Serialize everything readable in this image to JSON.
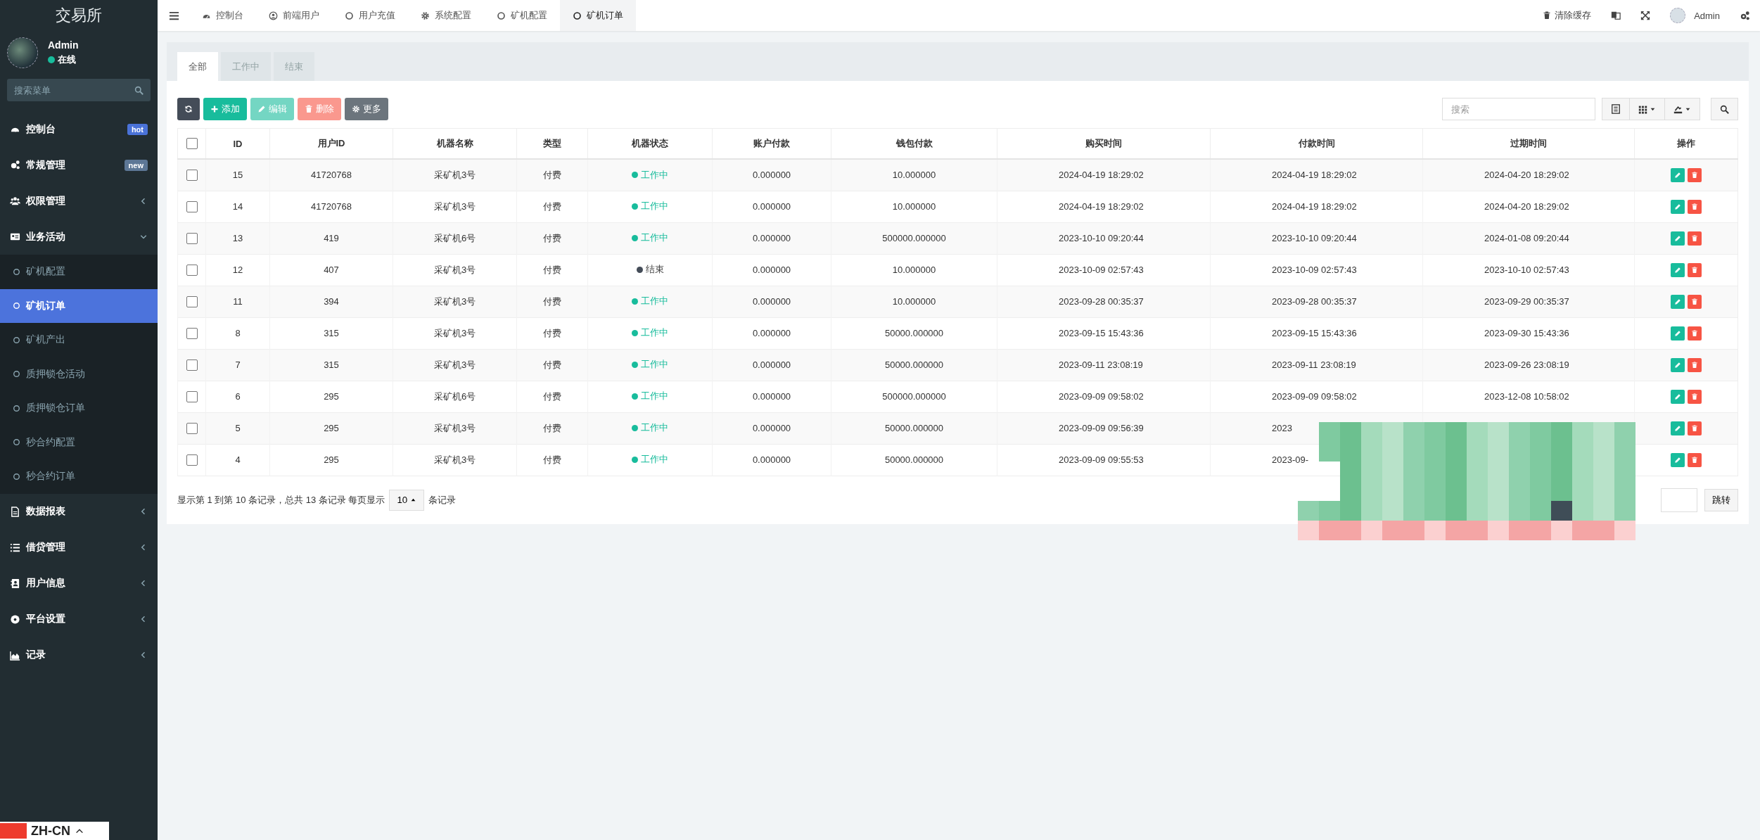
{
  "sidebar": {
    "brand": "交易所",
    "user": {
      "name": "Admin",
      "status": "在线",
      "online": true
    },
    "search": {
      "placeholder": "搜索菜单"
    },
    "items": [
      {
        "label": "控制台",
        "badge": {
          "text": "hot",
          "color": "#4a72d8"
        }
      },
      {
        "label": "常规管理",
        "badge": {
          "text": "new",
          "color": "#5d7796"
        }
      },
      {
        "label": "权限管理",
        "expanded": false
      },
      {
        "label": "业务活动",
        "expanded": true,
        "children": [
          {
            "label": "矿机配置",
            "selected": false
          },
          {
            "label": "矿机订单",
            "selected": true
          },
          {
            "label": "矿机产出",
            "selected": false
          },
          {
            "label": "质押锁仓活动",
            "selected": false
          },
          {
            "label": "质押锁仓订单",
            "selected": false
          },
          {
            "label": "秒合约配置",
            "selected": false
          },
          {
            "label": "秒合约订单",
            "selected": false
          }
        ]
      },
      {
        "label": "数据报表",
        "expanded": false
      },
      {
        "label": "借贷管理",
        "expanded": false
      },
      {
        "label": "用户信息",
        "expanded": false
      },
      {
        "label": "平台设置",
        "expanded": false
      },
      {
        "label": "记录",
        "expanded": false
      }
    ],
    "language": "ZH-CN"
  },
  "topbar": {
    "tabs": [
      {
        "label": "控制台",
        "selected": false
      },
      {
        "label": "前端用户",
        "selected": false
      },
      {
        "label": "用户充值",
        "selected": false
      },
      {
        "label": "系统配置",
        "selected": false
      },
      {
        "label": "矿机配置",
        "selected": false
      },
      {
        "label": "矿机订单",
        "selected": true
      }
    ],
    "clear_cache": "清除缓存",
    "user": "Admin"
  },
  "panel": {
    "tabs": [
      {
        "label": "全部",
        "selected": true
      },
      {
        "label": "工作中",
        "selected": false
      },
      {
        "label": "结束",
        "selected": false
      }
    ],
    "toolbar": [
      {
        "kind": "refresh",
        "disabled": false
      },
      {
        "kind": "add",
        "label": "添加",
        "disabled": false
      },
      {
        "kind": "edit",
        "label": "编辑",
        "disabled": true
      },
      {
        "kind": "delete",
        "label": "删除",
        "disabled": true
      },
      {
        "kind": "more",
        "label": "更多",
        "disabled": false
      }
    ],
    "search": {
      "placeholder": "搜索"
    },
    "table": {
      "select_all": {
        "checked": false
      },
      "columns": [
        "ID",
        "用户ID",
        "机器名称",
        "类型",
        "机器状态",
        "账户付款",
        "钱包付款",
        "购买时间",
        "付款时间",
        "过期时间",
        "操作"
      ],
      "rows": [
        {
          "id": "15",
          "user_id": "41720768",
          "machine": "采矿机3号",
          "type": "付费",
          "status": {
            "text": "工作中",
            "kind": "working"
          },
          "account_pay": "0.000000",
          "wallet_pay": "10.000000",
          "buy_time": "2024-04-19 18:29:02",
          "pay_time": "2024-04-19 18:29:02",
          "expire_time": "2024-04-20 18:29:02",
          "checked": false
        },
        {
          "id": "14",
          "user_id": "41720768",
          "machine": "采矿机3号",
          "type": "付费",
          "status": {
            "text": "工作中",
            "kind": "working"
          },
          "account_pay": "0.000000",
          "wallet_pay": "10.000000",
          "buy_time": "2024-04-19 18:29:02",
          "pay_time": "2024-04-19 18:29:02",
          "expire_time": "2024-04-20 18:29:02",
          "checked": false
        },
        {
          "id": "13",
          "user_id": "419",
          "machine": "采矿机6号",
          "type": "付费",
          "status": {
            "text": "工作中",
            "kind": "working"
          },
          "account_pay": "0.000000",
          "wallet_pay": "500000.000000",
          "buy_time": "2023-10-10 09:20:44",
          "pay_time": "2023-10-10 09:20:44",
          "expire_time": "2024-01-08 09:20:44",
          "checked": false
        },
        {
          "id": "12",
          "user_id": "407",
          "machine": "采矿机3号",
          "type": "付费",
          "status": {
            "text": "结束",
            "kind": "ended"
          },
          "account_pay": "0.000000",
          "wallet_pay": "10.000000",
          "buy_time": "2023-10-09 02:57:43",
          "pay_time": "2023-10-09 02:57:43",
          "expire_time": "2023-10-10 02:57:43",
          "checked": false
        },
        {
          "id": "11",
          "user_id": "394",
          "machine": "采矿机3号",
          "type": "付费",
          "status": {
            "text": "工作中",
            "kind": "working"
          },
          "account_pay": "0.000000",
          "wallet_pay": "10.000000",
          "buy_time": "2023-09-28 00:35:37",
          "pay_time": "2023-09-28 00:35:37",
          "expire_time": "2023-09-29 00:35:37",
          "checked": false
        },
        {
          "id": "8",
          "user_id": "315",
          "machine": "采矿机3号",
          "type": "付费",
          "status": {
            "text": "工作中",
            "kind": "working"
          },
          "account_pay": "0.000000",
          "wallet_pay": "50000.000000",
          "buy_time": "2023-09-15 15:43:36",
          "pay_time": "2023-09-15 15:43:36",
          "expire_time": "2023-09-30 15:43:36",
          "checked": false
        },
        {
          "id": "7",
          "user_id": "315",
          "machine": "采矿机3号",
          "type": "付费",
          "status": {
            "text": "工作中",
            "kind": "working"
          },
          "account_pay": "0.000000",
          "wallet_pay": "50000.000000",
          "buy_time": "2023-09-11 23:08:19",
          "pay_time": "2023-09-11 23:08:19",
          "expire_time": "2023-09-26 23:08:19",
          "checked": false
        },
        {
          "id": "6",
          "user_id": "295",
          "machine": "采矿机6号",
          "type": "付费",
          "status": {
            "text": "工作中",
            "kind": "working"
          },
          "account_pay": "0.000000",
          "wallet_pay": "500000.000000",
          "buy_time": "2023-09-09 09:58:02",
          "pay_time": "2023-09-09 09:58:02",
          "expire_time": "2023-12-08 10:58:02",
          "checked": false
        },
        {
          "id": "5",
          "user_id": "295",
          "machine": "采矿机3号",
          "type": "付费",
          "status": {
            "text": "工作中",
            "kind": "working"
          },
          "account_pay": "0.000000",
          "wallet_pay": "50000.000000",
          "buy_time": "2023-09-09 09:56:39",
          "pay_time": "2023",
          "checked": false
        },
        {
          "id": "4",
          "user_id": "295",
          "machine": "采矿机3号",
          "type": "付费",
          "status": {
            "text": "工作中",
            "kind": "working"
          },
          "account_pay": "0.000000",
          "wallet_pay": "50000.000000",
          "buy_time": "2023-09-09 09:55:53",
          "pay_time": "2023-09-",
          "checked": false
        }
      ]
    },
    "pagination": {
      "summary": "显示第 1 到第 10 条记录，总共 13 条记录 每页显示",
      "page_size": "10",
      "suffix": "条记录",
      "jump": "跳转"
    }
  }
}
